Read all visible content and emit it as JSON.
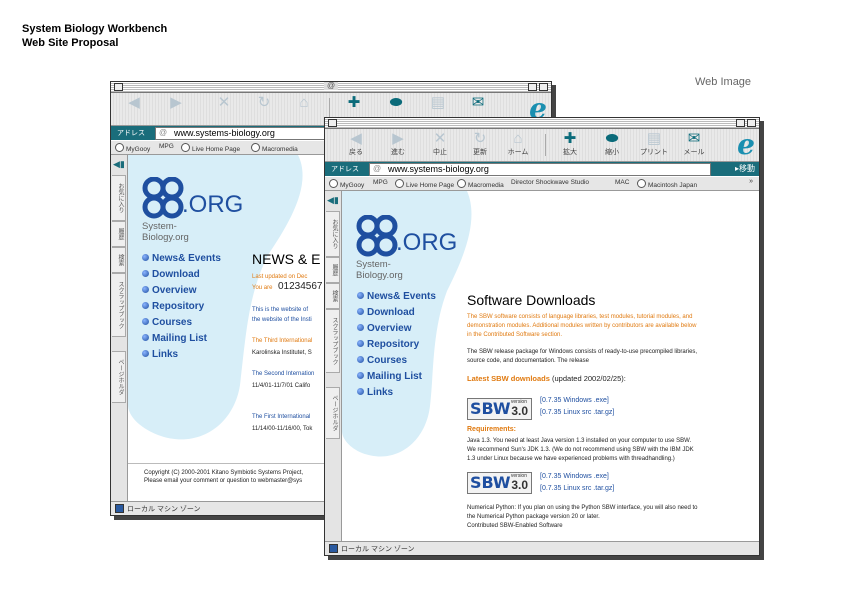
{
  "doc": {
    "title_line1": "System Biology Workbench",
    "title_line2": "Web Site Proposal",
    "web_image_label": "Web Image"
  },
  "browser": {
    "toolbar": [
      "戻る",
      "進む",
      "中止",
      "更新",
      "ホーム",
      "拡大",
      "縮小",
      "プリント",
      "メール"
    ],
    "toolbar_icons": [
      "back-icon",
      "forward-icon",
      "stop-icon",
      "refresh-icon",
      "home-icon",
      "zoom-in-icon",
      "zoom-out-icon",
      "print-icon",
      "mail-icon"
    ],
    "address_label": "アドレス",
    "address_url": "www.systems-biology.org",
    "go_label": "移動",
    "favorites": [
      "MyGooy",
      "MPG",
      "Live Home Page",
      "Macromedia",
      "Director Shockwave Studio",
      "MAC",
      "Macintosh Japan"
    ],
    "favorites_more": "»",
    "side_tabs": [
      "お気に入り",
      "履歴",
      "検索",
      "スクラップブック",
      "ページホルダ"
    ],
    "status_text": "ローカル マシン ゾーン",
    "ie_logo": "e",
    "titlebar_center": "@"
  },
  "site": {
    "logo_org": ".ORG",
    "logo_sub": "System-Biology.org",
    "nav": [
      "News& Events",
      "Download",
      "Overview",
      "Repository",
      "Courses",
      "Mailing List",
      "Links"
    ]
  },
  "back_page": {
    "heading": "NEWS & E",
    "updated": "Last updated on Dec",
    "you_are_label": "You are",
    "counter": "01234567",
    "intro1": "This is the website of",
    "intro2": "the website of the Insti",
    "item1": "The Third International",
    "item1_sub": "Karolinska Institutet, S",
    "item2": "The Second Internation",
    "item2_sub": "11/4/01-11/7/01  Califo",
    "item3": "The First International",
    "item3_sub": "11/14/00-11/16/00, Tok",
    "copyright": "Copyright (C) 2000-2001 Kitano Symbiotic Systems Project,",
    "email_line": "Please email your comment or question to webmaster@sys"
  },
  "front_page": {
    "heading": "Software Downloads",
    "intro1": "The SBW software consists of language libraries, test modules, tutorial modules, and",
    "intro2": "demonstration modules. Additional modules written by contributors are available below",
    "intro3": "in the Contributed Software section.",
    "release1": "The SBW release package for Windows consists of ready-to-use precompiled libraries,",
    "release2": "source code, and documentation. The release",
    "latest_label": "Latest SBW downloads",
    "latest_date": "(updated 2002/02/25):",
    "badge_text": "SBW",
    "badge_version_label": "version",
    "badge_version": "3.0",
    "dl_win": "[0.7.35 Windows .exe]",
    "dl_linux": "[0.7.35 Linux src .tar.gz]",
    "req_label": "Requirements:",
    "req1": "Java 1.3. You need at least Java version 1.3 installed on your computer to use SBW.",
    "req2": "We recommend Sun's JDK 1.3. (We do not recommend using SBW with the IBM JDK",
    "req3": "1.3 under Linux because we have experienced problems with threadhandling.)",
    "dl_win2": "[0.7.35 Windows .exe]",
    "dl_linux2": "[0.7.35 Linux src .tar.gz]",
    "np1": "Numerical Python: If you plan on using the Python SBW interface, you will also need to",
    "np2": "the Numerical Python package version 20 or later.",
    "np3": "Contributed SBW-Enabled Software"
  },
  "colors": {
    "accent_teal": "#1a6d7b",
    "link_blue": "#1f4fa0",
    "highlight_orange": "#e07a10",
    "blob_blue": "#d7eef8"
  }
}
